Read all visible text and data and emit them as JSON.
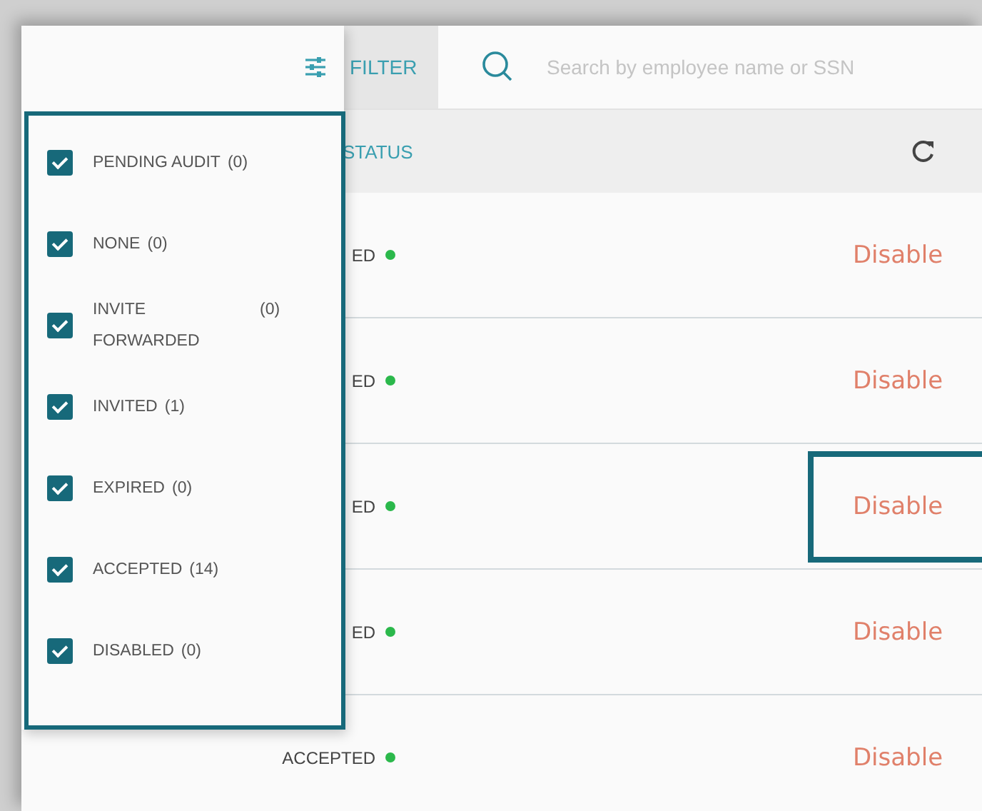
{
  "toolbar": {
    "filter_label": "FILTER",
    "search": {
      "placeholder": "Search by employee name or SSN"
    }
  },
  "table": {
    "columns": [
      {
        "label": "STATUS"
      }
    ],
    "rows": [
      {
        "status": "ED",
        "action": "Disable",
        "focused": false
      },
      {
        "status": "ED",
        "action": "Disable",
        "focused": false
      },
      {
        "status": "ED",
        "action": "Disable",
        "focused": true
      },
      {
        "status": "ED",
        "action": "Disable",
        "focused": false
      },
      {
        "status": "ACCEPTED",
        "action": "Disable",
        "focused": false
      }
    ]
  },
  "filter_menu": {
    "items": [
      {
        "label": "PENDING AUDIT",
        "count": "(0)",
        "checked": true
      },
      {
        "label": "NONE",
        "count": "(0)",
        "checked": true
      },
      {
        "label": "INVITE FORWARDED",
        "count": "(0)",
        "checked": true
      },
      {
        "label": "INVITED",
        "count": "(1)",
        "checked": true
      },
      {
        "label": "EXPIRED",
        "count": "(0)",
        "checked": true
      },
      {
        "label": "ACCEPTED",
        "count": "(14)",
        "checked": true
      },
      {
        "label": "DISABLED",
        "count": "(0)",
        "checked": true
      }
    ]
  }
}
